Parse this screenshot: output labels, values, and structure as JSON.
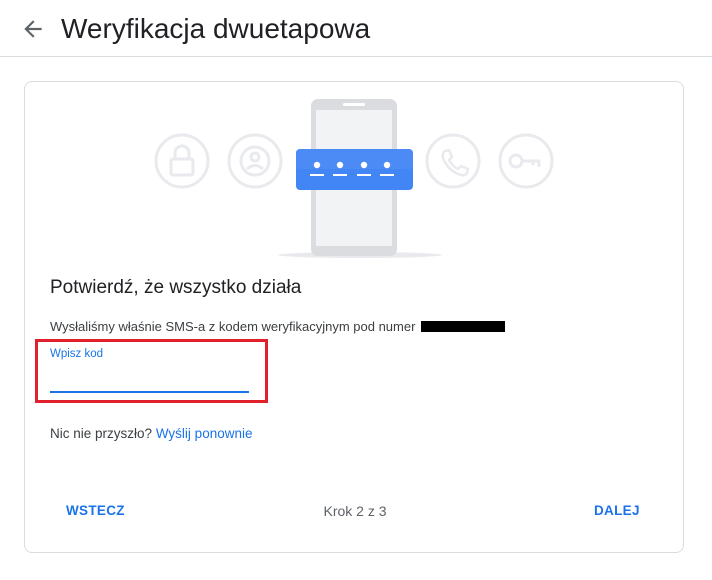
{
  "header": {
    "back_icon": "arrow-back-icon",
    "title": "Weryfikacja dwuetapowa"
  },
  "illustration": {
    "icons": [
      "lock-icon",
      "person-icon",
      "phone-icon",
      "key-icon"
    ],
    "code_dots": [
      "•",
      "•",
      "•",
      "•"
    ],
    "accent": "#4285f4"
  },
  "card": {
    "heading": "Potwierdź, że wszystko działa",
    "sms_text": "Wysłaliśmy właśnie SMS-a z kodem weryfikacyjnym pod numer",
    "code_field": {
      "label": "Wpisz kod",
      "value": ""
    },
    "resend_prefix": "Nic nie przyszło?",
    "resend_link": "Wyślij ponownie"
  },
  "footer": {
    "back_label": "WSTECZ",
    "step": "Krok 2 z 3",
    "next_label": "DALEJ"
  },
  "colors": {
    "accent": "#1a73e8",
    "highlight": "#e0202a"
  }
}
